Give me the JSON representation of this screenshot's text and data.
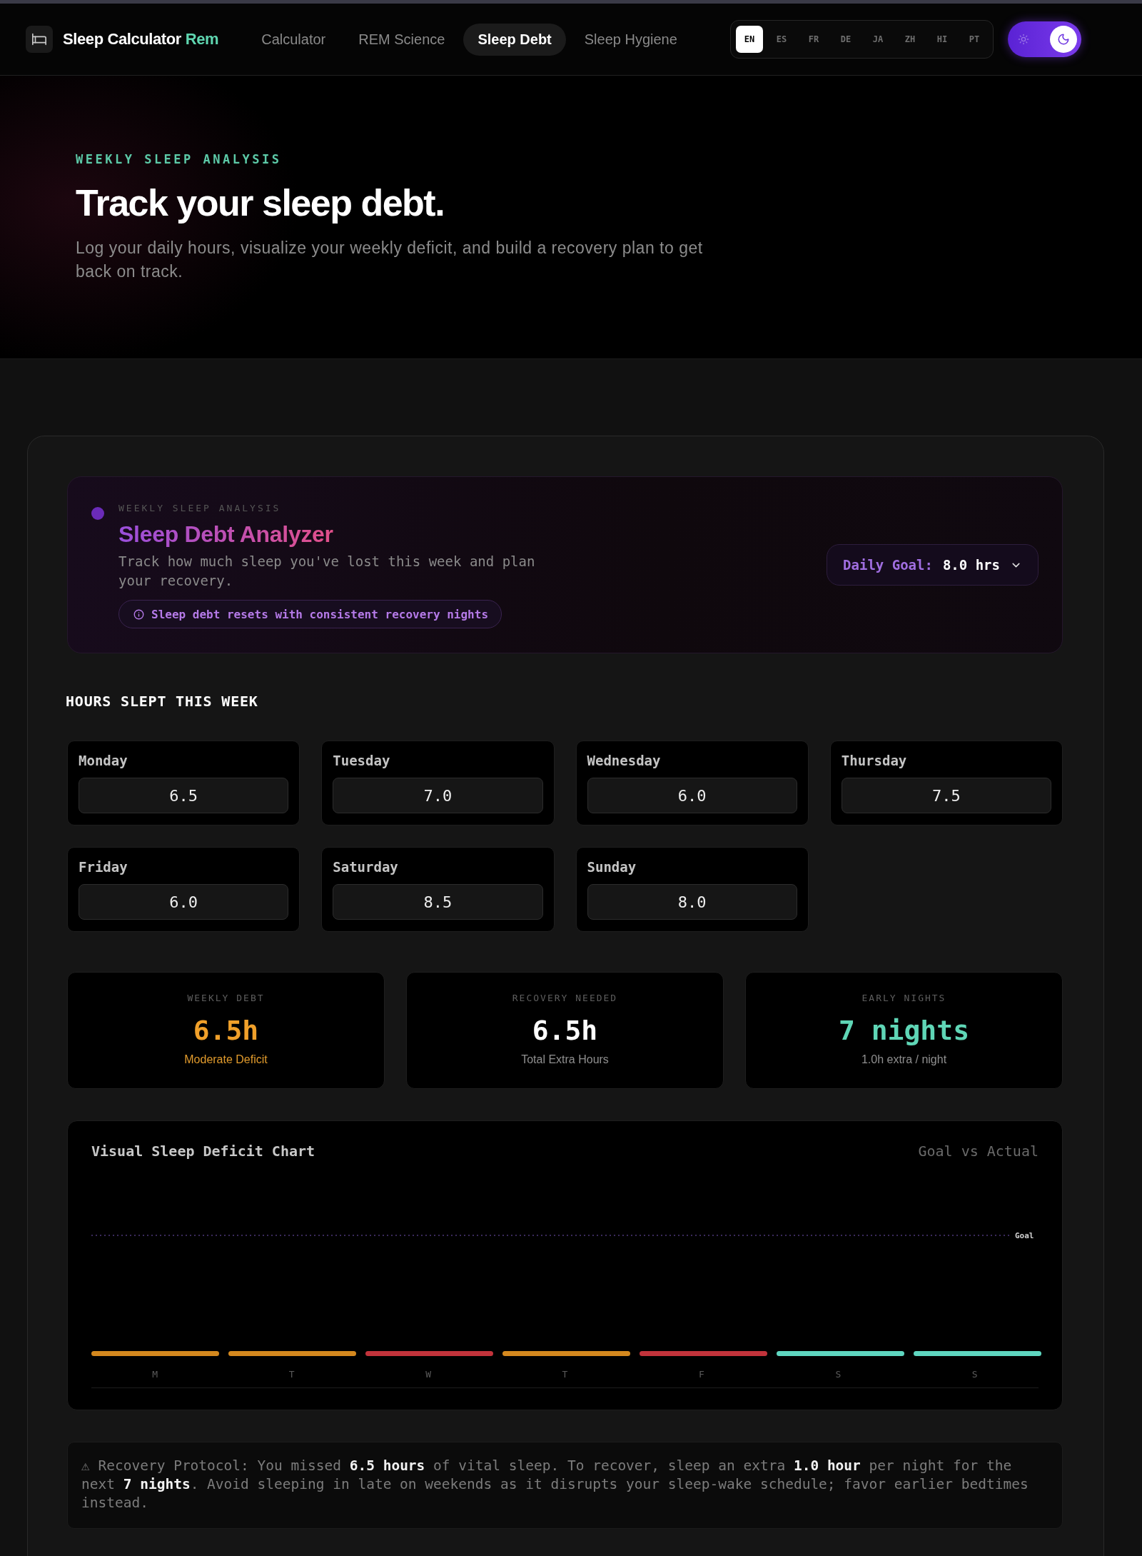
{
  "header": {
    "brand": {
      "name": "Sleep Calculator",
      "accent": "Rem"
    },
    "nav": [
      {
        "label": "Calculator",
        "selected": false
      },
      {
        "label": "REM Science",
        "selected": false
      },
      {
        "label": "Sleep Debt",
        "selected": true
      },
      {
        "label": "Sleep Hygiene",
        "selected": false
      }
    ],
    "languages": [
      {
        "code": "EN",
        "selected": true
      },
      {
        "code": "ES",
        "selected": false
      },
      {
        "code": "FR",
        "selected": false
      },
      {
        "code": "DE",
        "selected": false
      },
      {
        "code": "JA",
        "selected": false
      },
      {
        "code": "ZH",
        "selected": false
      },
      {
        "code": "HI",
        "selected": false
      },
      {
        "code": "PT",
        "selected": false
      }
    ],
    "theme_toggle": {
      "dark": true
    }
  },
  "hero": {
    "eyebrow": "WEEKLY SLEEP ANALYSIS",
    "title": "Track your sleep debt.",
    "subtitle": "Log your daily hours, visualize your weekly deficit, and build a recovery plan to get back on track."
  },
  "analyzer": {
    "eyebrow": "WEEKLY SLEEP ANALYSIS",
    "title": "Sleep Debt Analyzer",
    "description": "Track how much sleep you've lost this week and plan your recovery.",
    "tip": "Sleep debt resets with consistent recovery nights",
    "goal": {
      "label": "Daily Goal:",
      "value": "8.0 hrs"
    }
  },
  "hours": {
    "heading": "HOURS SLEPT THIS WEEK",
    "days": [
      {
        "day": "Monday",
        "value": "6.5"
      },
      {
        "day": "Tuesday",
        "value": "7.0"
      },
      {
        "day": "Wednesday",
        "value": "6.0"
      },
      {
        "day": "Thursday",
        "value": "7.5"
      },
      {
        "day": "Friday",
        "value": "6.0"
      },
      {
        "day": "Saturday",
        "value": "8.5"
      },
      {
        "day": "Sunday",
        "value": "8.0"
      }
    ]
  },
  "stats": [
    {
      "label": "WEEKLY DEBT",
      "value": "6.5h",
      "note": "Moderate Deficit",
      "kind": "warning"
    },
    {
      "label": "RECOVERY NEEDED",
      "value": "6.5h",
      "note": "Total Extra Hours",
      "kind": "neutral"
    },
    {
      "label": "EARLY NIGHTS",
      "value": "7 nights",
      "note": "1.0h extra / night",
      "kind": "success"
    }
  ],
  "chart": {
    "title": "Visual Sleep Deficit Chart",
    "legend": "Goal vs Actual",
    "goal_label": "Goal",
    "bars": [
      {
        "label": "M",
        "color": "#d4881e"
      },
      {
        "label": "T",
        "color": "#d4881e"
      },
      {
        "label": "W",
        "color": "#c2333b"
      },
      {
        "label": "T",
        "color": "#d4881e"
      },
      {
        "label": "F",
        "color": "#c2333b"
      },
      {
        "label": "S",
        "color": "#5fd6c0"
      },
      {
        "label": "S",
        "color": "#5fd6c0"
      }
    ]
  },
  "recovery_note": "⚠ Recovery Protocol: You missed **6.5 hours** of vital sleep. To recover, sleep an extra **1.0 hour** per night for the next **7 nights**. Avoid sleeping in late on weekends as it disrupts your sleep-wake schedule; favor earlier bedtimes instead."
}
